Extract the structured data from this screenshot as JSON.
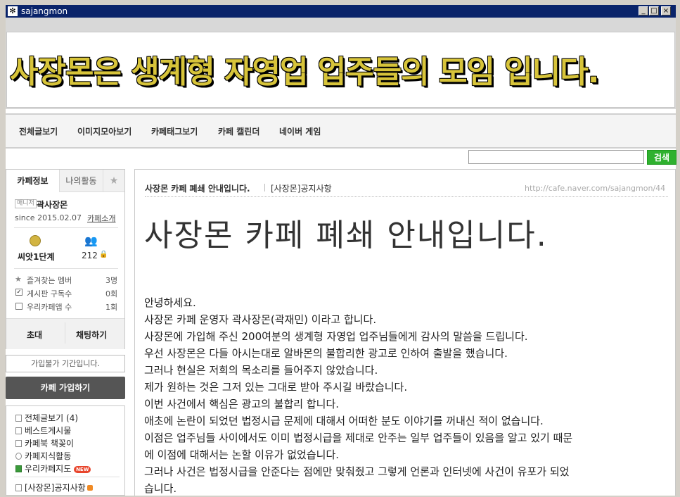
{
  "window": {
    "title": "sajangmon",
    "buttons": [
      "_",
      "□",
      "×"
    ]
  },
  "banner": {
    "text": "사장몬은 생계형 자영업 업주들의 모임 입니다."
  },
  "menu": {
    "items": [
      "전체글보기",
      "이미지모아보기",
      "카페태그보기",
      "카페 캘린더",
      "네이버 게임"
    ]
  },
  "search": {
    "placeholder": "",
    "button_label": "검색"
  },
  "sidebar": {
    "tabs": [
      "카페정보",
      "나의활동"
    ],
    "manager_badge": "매니저",
    "manager_name": "곽사장몬",
    "since": "since 2015.02.07",
    "intro_link": "카페소개",
    "level_label": "씨앗1단계",
    "member_count": "212",
    "stats": [
      {
        "label": "즐겨찾는 멤버",
        "value": "3명"
      },
      {
        "label": "게시판 구독수",
        "value": "0회"
      },
      {
        "label": "우리카페앱 수",
        "value": "1회"
      }
    ],
    "invite_button": "초대",
    "chat_button": "채팅하기",
    "join_notice": "가입불가 기간입니다.",
    "join_button": "카페 가입하기",
    "links": [
      {
        "label": "전체글보기",
        "count": "(4)"
      },
      {
        "label": "베스트게시물"
      },
      {
        "label": "카페북 책꽂이"
      },
      {
        "label": "카페지식활동"
      },
      {
        "label": "우리카페지도",
        "badge": "NEW"
      }
    ],
    "board_link": "[사장몬]공지사항"
  },
  "post": {
    "title": "사장몬 카페 폐쇄 안내입니다.",
    "board": "[사장몬]공지사항",
    "url": "http://cafe.naver.com/sajangmon/44",
    "headline": "사장몬 카페 폐쇄 안내입니다.",
    "lines": [
      "안녕하세요.",
      "사장몬 카페 운영자 곽사장몬(곽재민) 이라고 합니다.",
      "사장몬에 가입해 주신 200여분의 생계형 자영업 업주님들에게 감사의 말씀을 드립니다.",
      "우선 사장몬은 다들 아시는대로 알바몬의 불합리한 광고로 인하여 출발을 했습니다.",
      "그러나 현실은 저희의 목소리를 들어주지 않았습니다.",
      "제가 원하는 것은 그저 있는 그대로 받아 주시길 바랐습니다.",
      "이번 사건에서 핵심은 광고의 불합리 합니다.",
      "애초에 논란이 되었던 법정시급 문제에 대해서 어떠한 분도 이야기를 꺼내신 적이 없습니다.",
      "이점은 업주님들 사이에서도 이미 법정시급을 제대로 안주는 일부 업주들이 있음을 알고 있기 때문",
      "에 이점에 대해서는 논할 이유가 없었습니다.",
      "그러나 사건은 법정시급을 안준다는 점에만 맞춰줬고 그렇게 언론과 인터넷에 사건이 유포가 되었",
      "습니다."
    ]
  }
}
